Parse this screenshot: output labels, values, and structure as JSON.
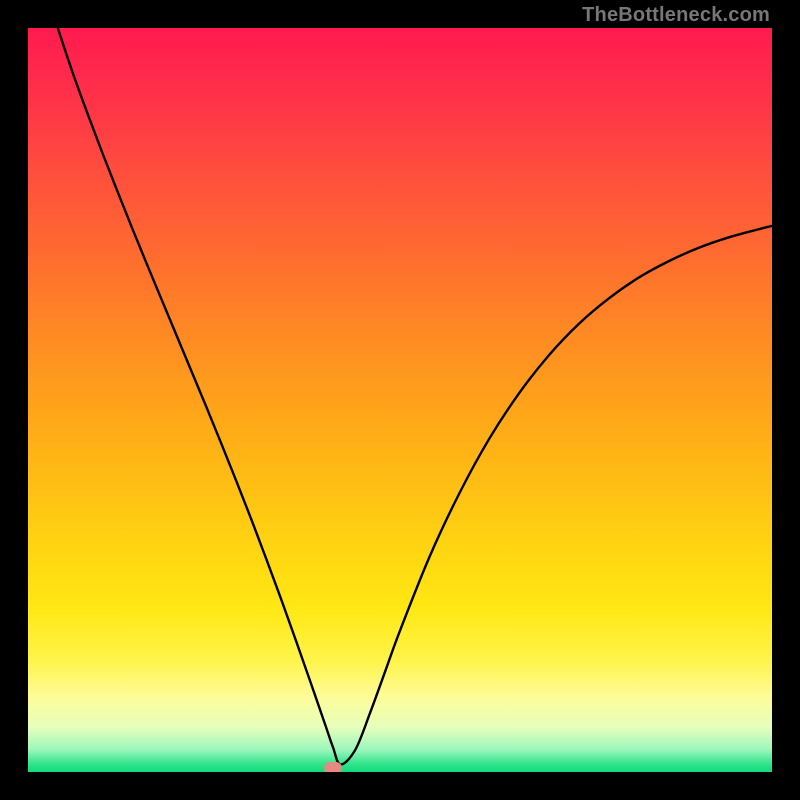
{
  "watermark": "TheBottleneck.com",
  "colors": {
    "frame": "#000000",
    "curve": "#000000",
    "marker": "#e48a82"
  },
  "chart_data": {
    "type": "line",
    "title": "",
    "xlabel": "",
    "ylabel": "",
    "xlim": [
      0,
      100
    ],
    "ylim": [
      0,
      100
    ],
    "grid": false,
    "legend": false,
    "series": [
      {
        "name": "bottleneck-curve",
        "x": [
          4,
          6,
          8,
          10,
          12,
          14,
          16,
          18,
          20,
          22,
          24,
          26,
          28,
          30,
          32,
          34,
          36,
          38,
          40,
          41,
          42,
          44,
          46,
          48,
          50,
          54,
          58,
          62,
          66,
          70,
          74,
          78,
          82,
          86,
          90,
          94,
          98,
          100
        ],
        "values": [
          100,
          94,
          88.5,
          83.2,
          78.1,
          73.1,
          68.2,
          63.4,
          58.6,
          53.8,
          49.0,
          44.1,
          39.1,
          34.0,
          28.7,
          23.3,
          17.7,
          12.0,
          6.2,
          3.3,
          1.0,
          3.0,
          8.0,
          13.5,
          19.0,
          29.0,
          37.5,
          44.8,
          50.9,
          56.0,
          60.2,
          63.6,
          66.4,
          68.6,
          70.4,
          71.8,
          72.9,
          73.4
        ]
      }
    ],
    "marker": {
      "x": 41,
      "y": 0.5
    },
    "gradient_stops": [
      {
        "pos": 0,
        "color": "#ff1a4f"
      },
      {
        "pos": 8,
        "color": "#ff2e4a"
      },
      {
        "pos": 18,
        "color": "#ff4a3f"
      },
      {
        "pos": 30,
        "color": "#ff6a30"
      },
      {
        "pos": 42,
        "color": "#ff8c22"
      },
      {
        "pos": 55,
        "color": "#ffae16"
      },
      {
        "pos": 68,
        "color": "#ffd012"
      },
      {
        "pos": 78,
        "color": "#ffe813"
      },
      {
        "pos": 85,
        "color": "#fff44a"
      },
      {
        "pos": 90,
        "color": "#fdfc9a"
      },
      {
        "pos": 94,
        "color": "#e6ffbb"
      },
      {
        "pos": 97,
        "color": "#9cf7bd"
      },
      {
        "pos": 99,
        "color": "#2de38a"
      },
      {
        "pos": 100,
        "color": "#13da7c"
      }
    ]
  }
}
